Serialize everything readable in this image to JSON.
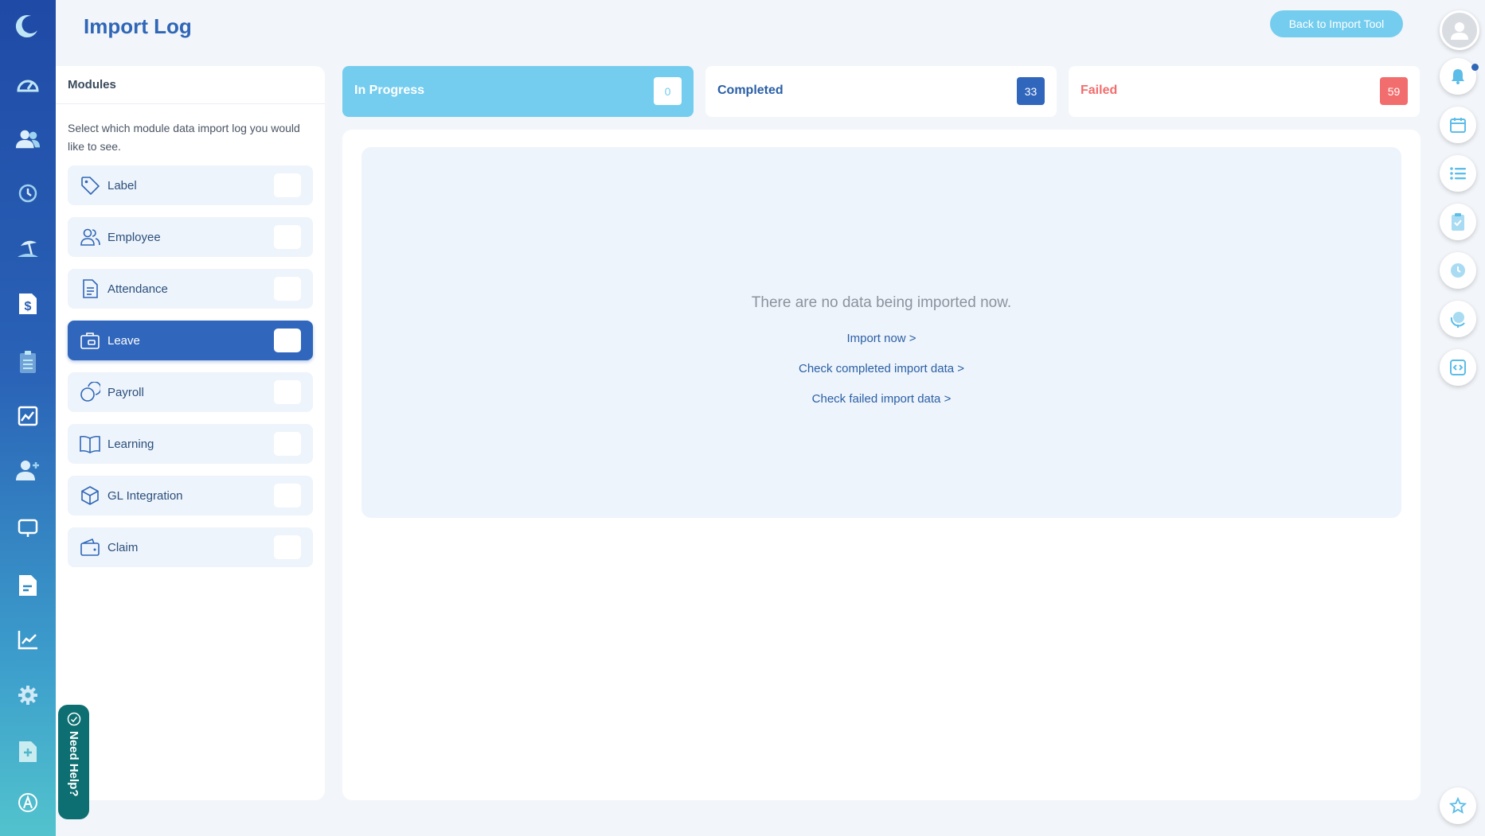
{
  "header": {
    "title": "Import Log",
    "back_button": "Back to Import Tool"
  },
  "left_nav": {
    "icons": [
      "moon-logo-icon",
      "dashboard-gauge-icon",
      "people-icon",
      "history-clock-icon",
      "leave-beach-icon",
      "payroll-dollar-icon",
      "clipboard-icon",
      "image-chart-icon",
      "add-user-icon",
      "monitor-icon",
      "document-icon",
      "analytics-chart-icon",
      "settings-gear-icon",
      "add-file-icon",
      "a-circle-icon"
    ]
  },
  "modules": {
    "title": "Modules",
    "description": "Select which module data import log you would like to see.",
    "items": [
      {
        "label": "Label",
        "icon": "tag-icon"
      },
      {
        "label": "Employee",
        "icon": "users-icon"
      },
      {
        "label": "Attendance",
        "icon": "document-list-icon"
      },
      {
        "label": "Leave",
        "icon": "briefcase-icon"
      },
      {
        "label": "Payroll",
        "icon": "coins-icon"
      },
      {
        "label": "Learning",
        "icon": "book-icon"
      },
      {
        "label": "GL Integration",
        "icon": "cube-icon"
      },
      {
        "label": "Claim",
        "icon": "wallet-icon"
      }
    ],
    "active_index": 3
  },
  "status": {
    "in_progress": {
      "label": "In Progress",
      "count": "0"
    },
    "completed": {
      "label": "Completed",
      "count": "33"
    },
    "failed": {
      "label": "Failed",
      "count": "59"
    }
  },
  "main": {
    "empty_message": "There are no data being imported now.",
    "links": {
      "import_now": "Import now >",
      "check_completed": "Check completed import data >",
      "check_failed": "Check failed import data >"
    }
  },
  "need_help": "Need Help?",
  "right_rail": {
    "icons": [
      "bell-icon",
      "calendar-icon",
      "list-icon",
      "clipboard-check-icon",
      "clock-icon",
      "globe-icon",
      "code-icon",
      "star-icon"
    ]
  },
  "colors": {
    "primary": "#2f66b7",
    "in_progress_bg": "#74cdef",
    "completed_badge": "#3066bc",
    "failed": "#f26d6d"
  }
}
